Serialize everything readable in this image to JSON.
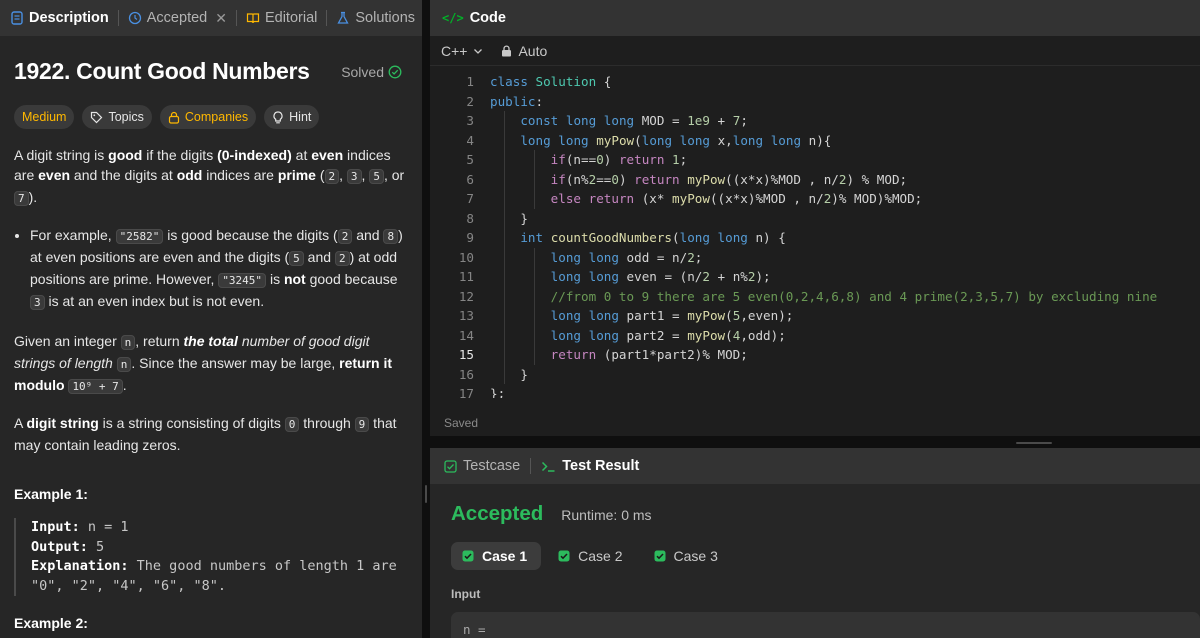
{
  "left_tabs": [
    {
      "label": "Description",
      "icon": "description-icon"
    },
    {
      "label": "Accepted",
      "icon": "history-icon"
    },
    {
      "label": "Editorial",
      "icon": "book-icon"
    },
    {
      "label": "Solutions",
      "icon": "flask-icon"
    }
  ],
  "problem": {
    "title": "1922. Count Good Numbers",
    "status": "Solved",
    "pills": [
      "Medium",
      "Topics",
      "Companies",
      "Hint"
    ],
    "desc_p1": {
      "t1": "A digit string is ",
      "b1": "good",
      "t2": " if the digits ",
      "b2": "(0-indexed)",
      "t3": " at ",
      "b3": "even",
      "t4": " indices are ",
      "b4": "even",
      "t5": " and the digits at ",
      "b5": "odd",
      "t6": " indices are ",
      "b6": "prime",
      "t7": " (",
      "c1": "2",
      "t8": ", ",
      "c2": "3",
      "t9": ", ",
      "c3": "5",
      "t10": ", or ",
      "c4": "7",
      "t11": ")."
    },
    "bullet": {
      "t1": "For example, ",
      "c1": "\"2582\"",
      "t2": " is good because the digits (",
      "c2": "2",
      "t3": " and ",
      "c3": "8",
      "t4": ") at even positions are even and the digits (",
      "c4": "5",
      "t5": " and ",
      "c5": "2",
      "t6": ") at odd positions are prime. However, ",
      "c6": "\"3245\"",
      "t7": " is ",
      "b1": "not",
      "t8": " good because ",
      "c7": "3",
      "t9": " is at an even index but is not even."
    },
    "desc_p2": {
      "t1": "Given an integer ",
      "c1": "n",
      "t2": ", return ",
      "bi1": "the total",
      "i1": " number of good digit strings of length ",
      "c2": "n",
      "t3": ". Since the answer may be large, ",
      "b1": "return it modulo",
      "t4": " ",
      "c3": "10⁹ + 7",
      "t5": "."
    },
    "desc_p3": {
      "t1": "A ",
      "b1": "digit string",
      "t2": " is a string consisting of digits ",
      "c1": "0",
      "t3": " through ",
      "c2": "9",
      "t4": " that may contain leading zeros."
    },
    "example1_heading": "Example 1:",
    "example1": {
      "input_k": "Input:",
      "input_v": " n = 1",
      "output_k": "Output:",
      "output_v": " 5",
      "expl_k": "Explanation:",
      "expl_v": " The good numbers of length 1 are",
      "expl_v2": "\"0\", \"2\", \"4\", \"6\", \"8\"."
    },
    "example2_heading": "Example 2:"
  },
  "code_panel": {
    "title": "Code",
    "language": "C++",
    "mode": "Auto",
    "saved_label": "Saved",
    "current_line": 15
  },
  "code_lines": [
    "class Solution {",
    "public:",
    "    const long long MOD = 1e9 + 7;",
    "    long long myPow(long long x,long long n){",
    "        if(n==0) return 1;",
    "        if(n%2==0) return myPow((x*x)%MOD , n/2) % MOD;",
    "        else return (x* myPow((x*x)%MOD , n/2)% MOD)%MOD;",
    "    }",
    "    int countGoodNumbers(long long n) {",
    "        long long odd = n/2;",
    "        long long even = (n/2 + n%2);",
    "        //from 0 to 9 there are 5 even(0,2,4,6,8) and 4 prime(2,3,5,7) by excluding nine",
    "        long long part1 = myPow(5,even);",
    "        long long part2 = myPow(4,odd);",
    "        return (part1*part2)% MOD;",
    "    }",
    "};"
  ],
  "result_panel": {
    "tabs": [
      "Testcase",
      "Test Result"
    ],
    "verdict": "Accepted",
    "runtime": "Runtime: 0 ms",
    "cases": [
      "Case 1",
      "Case 2",
      "Case 3"
    ],
    "input_label": "Input",
    "input_value": "n ="
  },
  "colors": {
    "accent_green": "#2cbb5d",
    "medium_yellow": "#ffb800",
    "bg_panel": "#262626"
  }
}
